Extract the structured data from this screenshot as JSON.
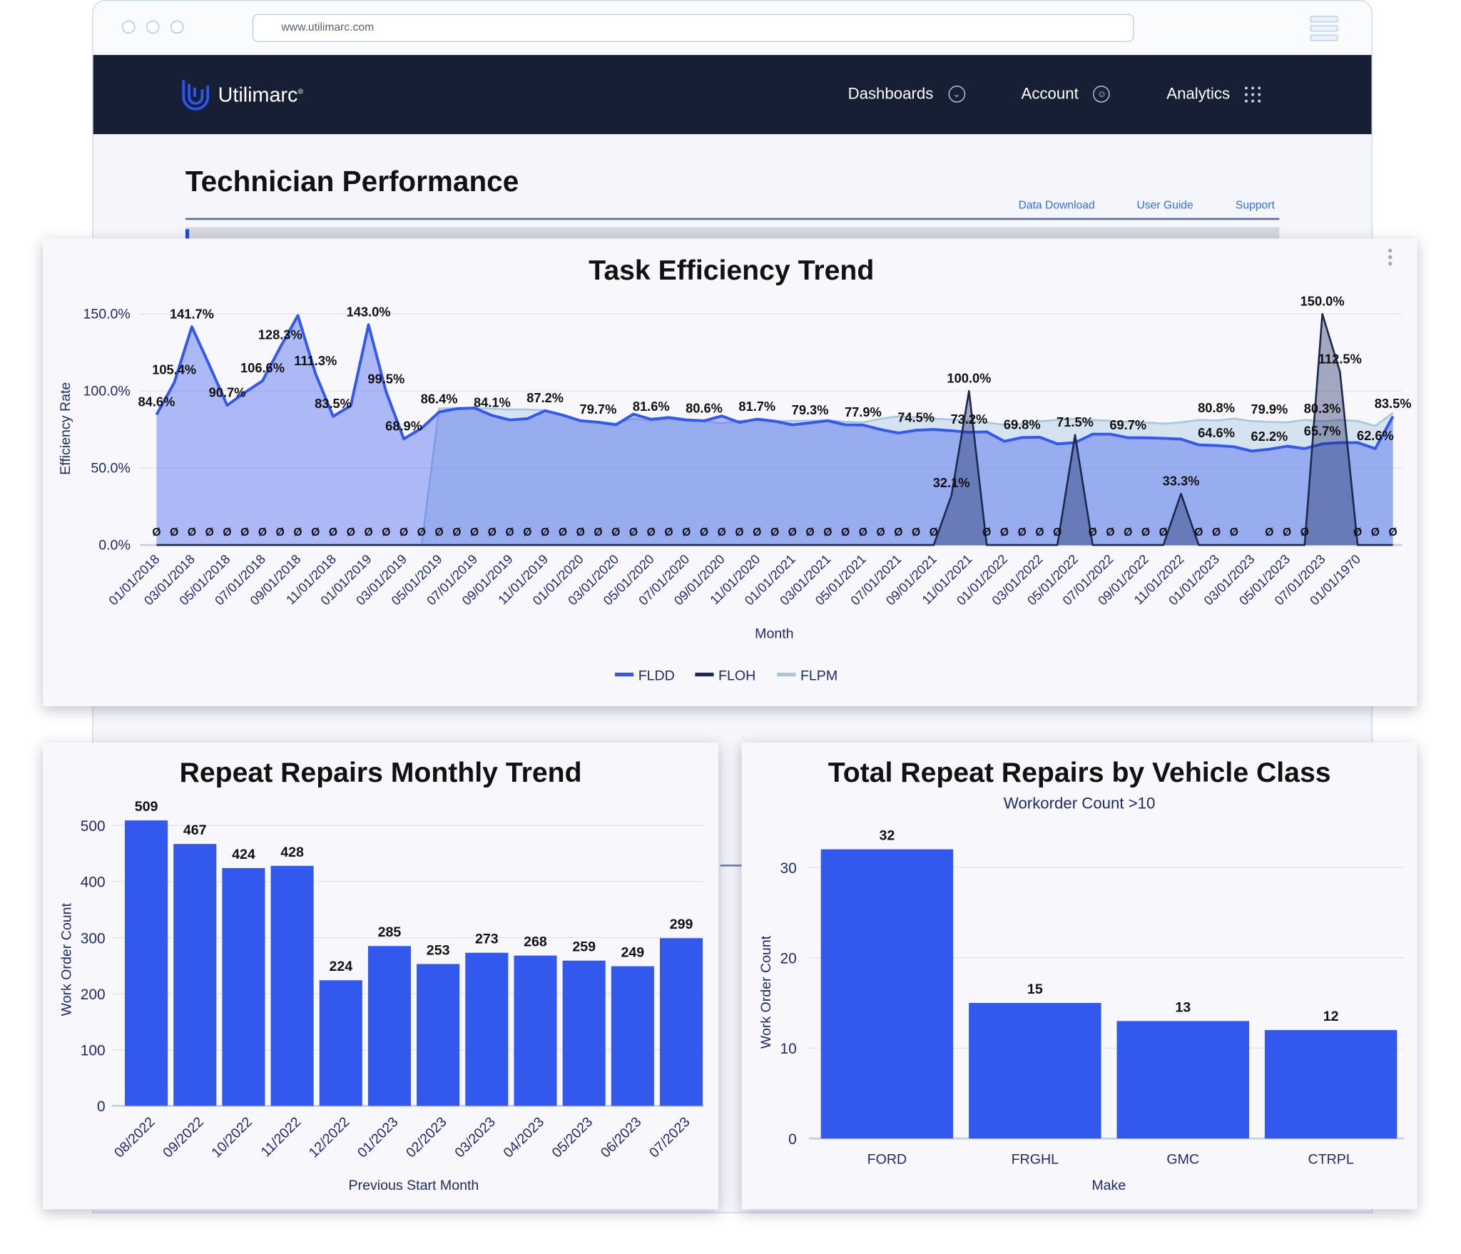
{
  "browser": {
    "url": "www.utilimarc.com"
  },
  "nav": {
    "brand": "Utilimarc",
    "brand_mark": "®",
    "items": [
      {
        "label": "Dashboards",
        "icon": "chevron-circle-icon"
      },
      {
        "label": "Account",
        "icon": "user-circle-icon"
      },
      {
        "label": "Analytics",
        "icon": "grid-dots-icon"
      }
    ]
  },
  "page": {
    "title": "Technician Performance",
    "links": [
      "Data Download",
      "User Guide",
      "Support"
    ]
  },
  "colors": {
    "bar": "#3358ee",
    "fldd": "#3358ee",
    "floh": "#1b2a4f",
    "flpm": "#a9c6dd",
    "nav_bg": "#161f33",
    "link": "#2f6fee"
  },
  "chart_data": [
    {
      "type": "area",
      "title": "Task Efficiency Trend",
      "xlabel": "Month",
      "ylabel": "Efficiency Rate",
      "ylim": [
        0,
        150
      ],
      "yticks": [
        "0.0%",
        "50.0%",
        "100.0%",
        "150.0%"
      ],
      "ytick_values": [
        0,
        50,
        100,
        150
      ],
      "xtick_labels": [
        "01/01/2018",
        "03/01/2018",
        "05/01/2018",
        "07/01/2018",
        "09/01/2018",
        "11/01/2018",
        "01/01/2019",
        "03/01/2019",
        "05/01/2019",
        "07/01/2019",
        "09/01/2019",
        "11/01/2019",
        "01/01/2020",
        "03/01/2020",
        "05/01/2020",
        "07/01/2020",
        "09/01/2020",
        "11/01/2020",
        "01/01/2021",
        "03/01/2021",
        "05/01/2021",
        "07/01/2021",
        "09/01/2021",
        "11/01/2021",
        "01/01/2022",
        "03/01/2022",
        "05/01/2022",
        "07/01/2022",
        "09/01/2022",
        "11/01/2022",
        "01/01/2023",
        "03/01/2023",
        "05/01/2023",
        "07/01/2023",
        "01/01/1970"
      ],
      "grid": true,
      "legend": "bottom",
      "series": [
        {
          "name": "FLDD",
          "color": "#3358ee",
          "values": [
            84.6,
            105.4,
            141.7,
            116.5,
            90.7,
            99,
            106.6,
            128.3,
            149,
            111.3,
            83.5,
            90.5,
            143.0,
            99.5,
            68.9,
            75.8,
            86.4,
            88.5,
            89,
            84.1,
            81.2,
            82,
            87.2,
            84.3,
            80.7,
            79.7,
            78,
            85,
            81.6,
            82.8,
            81.2,
            80.6,
            83.8,
            79.6,
            81.7,
            80.4,
            78,
            79.3,
            80.7,
            78,
            77.9,
            75,
            72.7,
            74.5,
            75,
            74.2,
            73.2,
            73.5,
            67.3,
            69.8,
            70,
            65.7,
            66.5,
            72,
            72,
            69.7,
            69.6,
            69.3,
            68.8,
            65,
            64.6,
            63.8,
            61,
            62.2,
            64.2,
            62.6,
            65.7,
            66.5,
            66.5,
            62.6,
            83.5
          ]
        },
        {
          "name": "FLOH",
          "color": "#1b2a4f",
          "values": [
            0,
            0,
            0,
            0,
            0,
            0,
            0,
            0,
            0,
            0,
            0,
            0,
            0,
            0,
            0,
            0,
            0,
            0,
            0,
            0,
            0,
            0,
            0,
            0,
            0,
            0,
            0,
            0,
            0,
            0,
            0,
            0,
            0,
            0,
            0,
            0,
            0,
            0,
            0,
            0,
            0,
            0,
            0,
            0,
            0,
            32.1,
            100.0,
            0,
            0,
            0,
            0,
            0,
            71.5,
            0,
            0,
            0,
            0,
            0,
            33.3,
            0,
            0,
            0,
            0,
            0,
            0,
            0,
            150.0,
            112.5,
            0,
            0,
            0
          ]
        },
        {
          "name": "FLPM",
          "color": "#a9c6dd",
          "values": [
            null,
            null,
            null,
            null,
            null,
            null,
            null,
            null,
            null,
            null,
            null,
            null,
            null,
            null,
            null,
            0,
            88.6,
            89,
            89,
            88.5,
            88,
            88,
            87.5,
            84,
            81,
            80,
            79,
            82,
            80.5,
            82,
            80.5,
            80.5,
            79,
            80.7,
            81,
            80.5,
            80.5,
            80.7,
            81,
            80,
            79.6,
            82,
            83.5,
            83,
            82,
            81.5,
            80.5,
            79.6,
            78,
            78.6,
            80.4,
            81.2,
            82,
            81.2,
            80.5,
            80,
            79.6,
            78.8,
            79.6,
            81.2,
            80.8,
            82,
            80.5,
            79.9,
            79.6,
            81.2,
            80.3,
            81.2,
            80.5,
            77.3,
            85.8
          ]
        }
      ],
      "data_labels": [
        {
          "series": "FLDD",
          "index": 0,
          "text": "84.6%"
        },
        {
          "series": "FLDD",
          "index": 1,
          "text": "105.4%"
        },
        {
          "series": "FLDD",
          "index": 2,
          "text": "141.7%"
        },
        {
          "series": "FLDD",
          "index": 4,
          "text": "90.7%"
        },
        {
          "series": "FLDD",
          "index": 6,
          "text": "106.6%"
        },
        {
          "series": "FLDD",
          "index": 7,
          "text": "128.3%"
        },
        {
          "series": "FLDD",
          "index": 9,
          "text": "111.3%"
        },
        {
          "series": "FLDD",
          "index": 10,
          "text": "83.5%"
        },
        {
          "series": "FLDD",
          "index": 12,
          "text": "143.0%"
        },
        {
          "series": "FLDD",
          "index": 13,
          "text": "99.5%"
        },
        {
          "series": "FLDD",
          "index": 14,
          "text": "68.9%"
        },
        {
          "series": "FLDD",
          "index": 16,
          "text": "86.4%"
        },
        {
          "series": "FLDD",
          "index": 19,
          "text": "84.1%"
        },
        {
          "series": "FLDD",
          "index": 22,
          "text": "87.2%"
        },
        {
          "series": "FLDD",
          "index": 25,
          "text": "79.7%"
        },
        {
          "series": "FLDD",
          "index": 28,
          "text": "81.6%"
        },
        {
          "series": "FLDD",
          "index": 31,
          "text": "80.6%"
        },
        {
          "series": "FLDD",
          "index": 34,
          "text": "81.7%"
        },
        {
          "series": "FLDD",
          "index": 37,
          "text": "79.3%"
        },
        {
          "series": "FLDD",
          "index": 40,
          "text": "77.9%"
        },
        {
          "series": "FLDD",
          "index": 43,
          "text": "74.5%"
        },
        {
          "series": "FLDD",
          "index": 46,
          "text": "73.2%"
        },
        {
          "series": "FLDD",
          "index": 49,
          "text": "69.8%"
        },
        {
          "series": "FLDD",
          "index": 55,
          "text": "69.7%"
        },
        {
          "series": "FLDD",
          "index": 60,
          "text": "64.6%"
        },
        {
          "series": "FLDD",
          "index": 63,
          "text": "62.2%"
        },
        {
          "series": "FLDD",
          "index": 66,
          "text": "65.7%"
        },
        {
          "series": "FLDD",
          "index": 69,
          "text": "62.6%"
        },
        {
          "series": "FLDD",
          "index": 70,
          "text": "83.5%"
        },
        {
          "series": "FLPM",
          "index": 60,
          "text": "80.8%"
        },
        {
          "series": "FLPM",
          "index": 63,
          "text": "79.9%"
        },
        {
          "series": "FLPM",
          "index": 66,
          "text": "80.3%"
        },
        {
          "series": "FLOH",
          "index": 45,
          "text": "32.1%"
        },
        {
          "series": "FLOH",
          "index": 46,
          "text": "100.0%"
        },
        {
          "series": "FLOH",
          "index": 52,
          "text": "71.5%"
        },
        {
          "series": "FLOH",
          "index": 58,
          "text": "33.3%"
        },
        {
          "series": "FLOH",
          "index": 66,
          "text": "150.0%"
        },
        {
          "series": "FLOH",
          "index": 67,
          "text": "112.5%"
        }
      ],
      "zero_label": "Ø",
      "zero_label_skip": [
        62
      ]
    },
    {
      "type": "bar",
      "title": "Repeat Repairs Monthly Trend",
      "xlabel": "Previous Start Month",
      "ylabel": "Work Order Count",
      "ylim": [
        0,
        500
      ],
      "yticks": [
        "0",
        "100",
        "200",
        "300",
        "400",
        "500"
      ],
      "ytick_values": [
        0,
        100,
        200,
        300,
        400,
        500
      ],
      "categories": [
        "08/2022",
        "09/2022",
        "10/2022",
        "11/2022",
        "12/2022",
        "01/2023",
        "02/2023",
        "03/2023",
        "04/2023",
        "05/2023",
        "06/2023",
        "07/2023"
      ],
      "values": [
        509,
        467,
        424,
        428,
        224,
        285,
        253,
        273,
        268,
        259,
        249,
        299
      ],
      "value_labels": [
        "509",
        "467",
        "424",
        "428",
        "224",
        "285",
        "253",
        "273",
        "268",
        "259",
        "249",
        "299"
      ],
      "grid": true
    },
    {
      "type": "bar",
      "title": "Total Repeat Repairs by Vehicle Class",
      "subtitle": "Workorder Count >10",
      "xlabel": "Make",
      "ylabel": "Work Order Count",
      "ylim": [
        0,
        30
      ],
      "yticks": [
        "0",
        "10",
        "20",
        "30"
      ],
      "ytick_values": [
        0,
        10,
        20,
        30
      ],
      "categories": [
        "FORD",
        "FRGHL",
        "GMC",
        "CTRPL"
      ],
      "values": [
        32,
        15,
        13,
        12
      ],
      "value_labels": [
        "32",
        "15",
        "13",
        "12"
      ],
      "grid": true
    }
  ]
}
